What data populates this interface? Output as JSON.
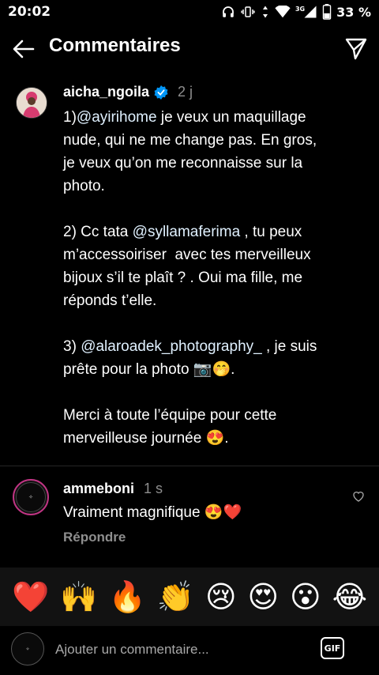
{
  "statusbar": {
    "time": "20:02",
    "battery": "33 %",
    "network": "3G"
  },
  "header": {
    "title": "Commentaires"
  },
  "caption": {
    "username": "aicha_ngoila",
    "timestamp": "2 j",
    "lines": [
      {
        "parts": [
          {
            "t": "1)"
          },
          {
            "t": "@ayirihome",
            "mention": true
          },
          {
            "t": " je veux un maquillage"
          }
        ]
      },
      {
        "parts": [
          {
            "t": "nude, qui ne me change pas. En gros,"
          }
        ]
      },
      {
        "parts": [
          {
            "t": "je veux qu’on me reconnaisse sur la"
          }
        ]
      },
      {
        "parts": [
          {
            "t": "photo."
          }
        ]
      },
      {
        "parts": [
          {
            "t": ""
          }
        ]
      },
      {
        "parts": [
          {
            "t": "2) Cc tata "
          },
          {
            "t": "@syllamaferima",
            "mention": true
          },
          {
            "t": " , tu peux"
          }
        ]
      },
      {
        "parts": [
          {
            "t": "m’accessoiriser  avec tes merveilleux"
          }
        ]
      },
      {
        "parts": [
          {
            "t": "bijoux s’il te plaît ? . Oui ma fille, me"
          }
        ]
      },
      {
        "parts": [
          {
            "t": "réponds t’elle."
          }
        ]
      },
      {
        "parts": [
          {
            "t": ""
          }
        ]
      },
      {
        "parts": [
          {
            "t": "3) "
          },
          {
            "t": "@alaroadek_photography_",
            "mention": true
          },
          {
            "t": " , je suis"
          }
        ]
      },
      {
        "parts": [
          {
            "t": "prête pour la photo 📷🤭."
          }
        ]
      },
      {
        "parts": [
          {
            "t": ""
          }
        ]
      },
      {
        "parts": [
          {
            "t": "Merci à toute l’équipe pour cette"
          }
        ]
      },
      {
        "parts": [
          {
            "t": "merveilleuse journée 😍."
          }
        ]
      }
    ]
  },
  "comment": {
    "username": "ammeboni",
    "timestamp": "1 s",
    "text": "Vraiment magnifique 😍❤️",
    "reply_label": "Répondre"
  },
  "emoji_bar": [
    "❤️",
    "🙌",
    "🔥",
    "👏",
    "😢",
    "😍",
    "😮",
    "😂"
  ],
  "input": {
    "placeholder": "Ajouter un commentaire...",
    "gif_label": "GIF"
  },
  "colors": {
    "background": "#000000",
    "muted": "#8e8e8e",
    "verified": "#0095f6",
    "mention": "#e0f1ff"
  }
}
